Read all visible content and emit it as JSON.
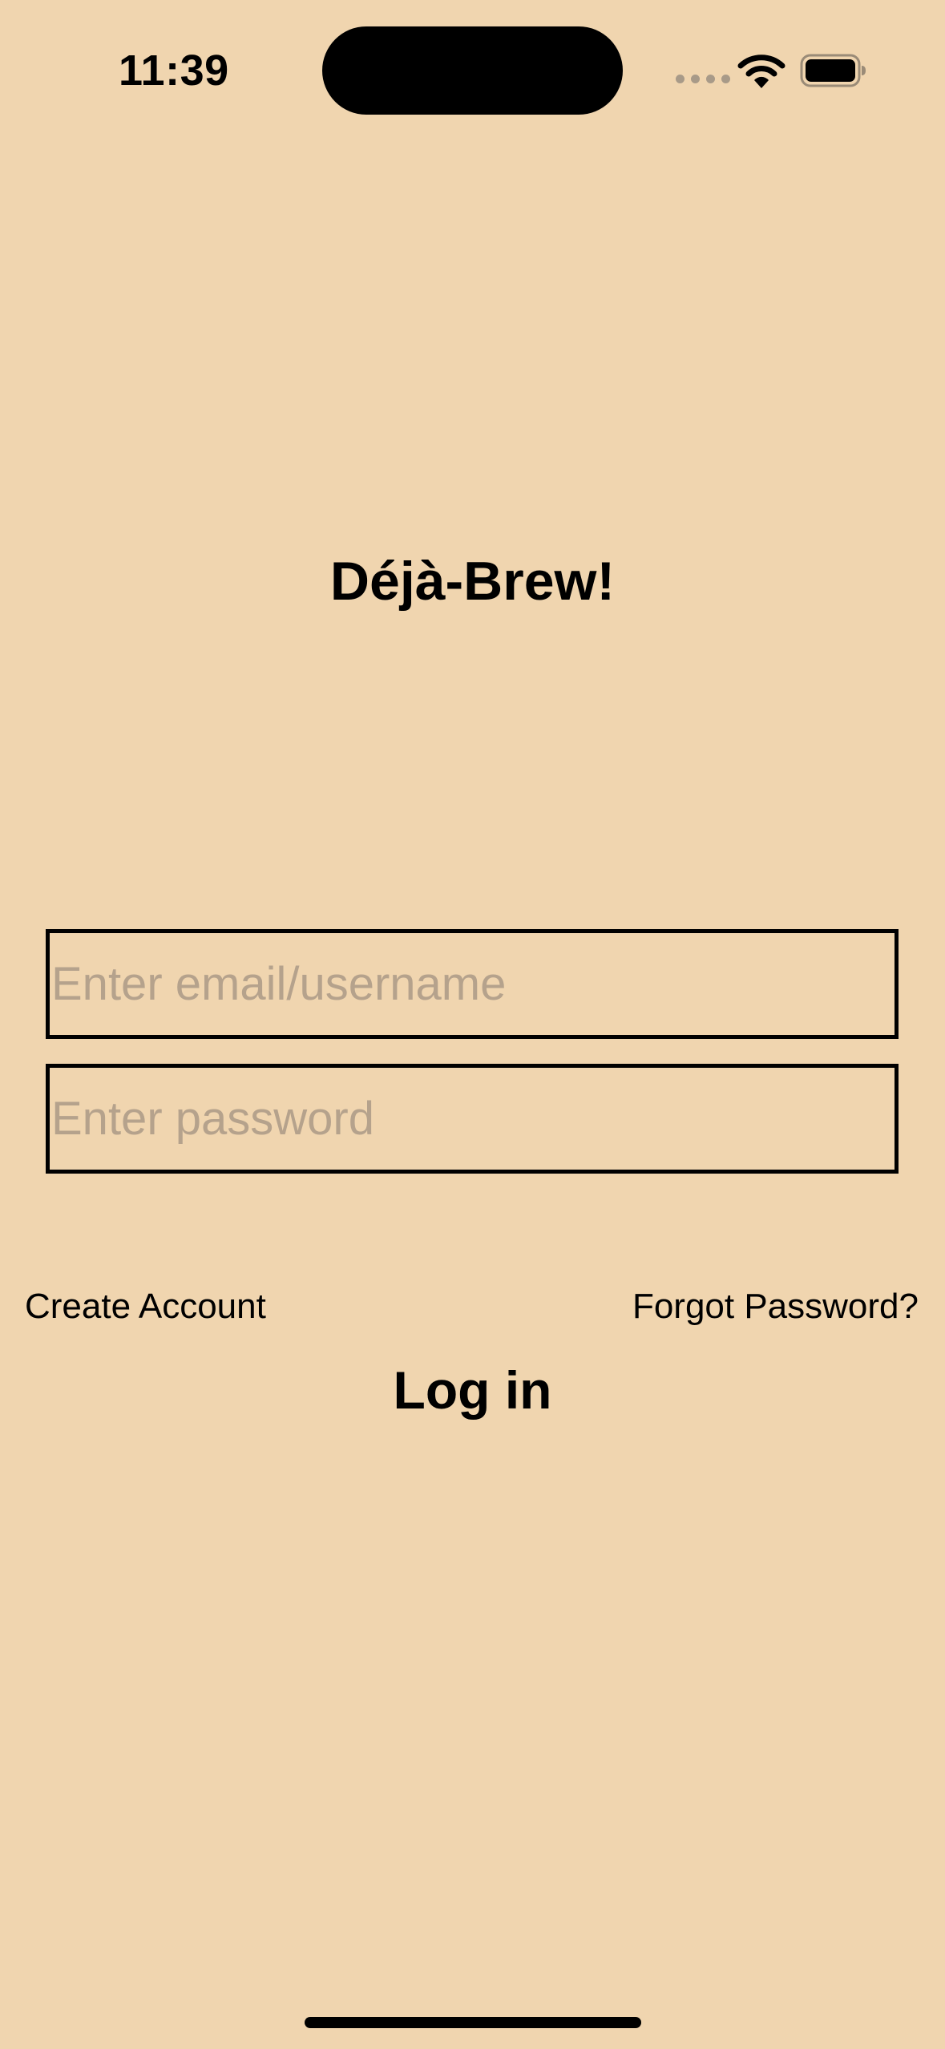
{
  "status_bar": {
    "time": "11:39",
    "signal_icon": "cellular-signal-dots",
    "wifi_icon": "wifi-icon",
    "battery_icon": "battery-full-icon"
  },
  "app": {
    "title": "Déjà-Brew!"
  },
  "login_form": {
    "email_placeholder": "Enter email/username",
    "email_value": "",
    "password_placeholder": "Enter password",
    "password_value": ""
  },
  "links": {
    "create_account": "Create Account",
    "forgot_password": "Forgot Password?"
  },
  "actions": {
    "login": "Log in"
  },
  "colors": {
    "background": "#F0D5AF",
    "placeholder": "#B5A28C",
    "text": "#000000"
  }
}
